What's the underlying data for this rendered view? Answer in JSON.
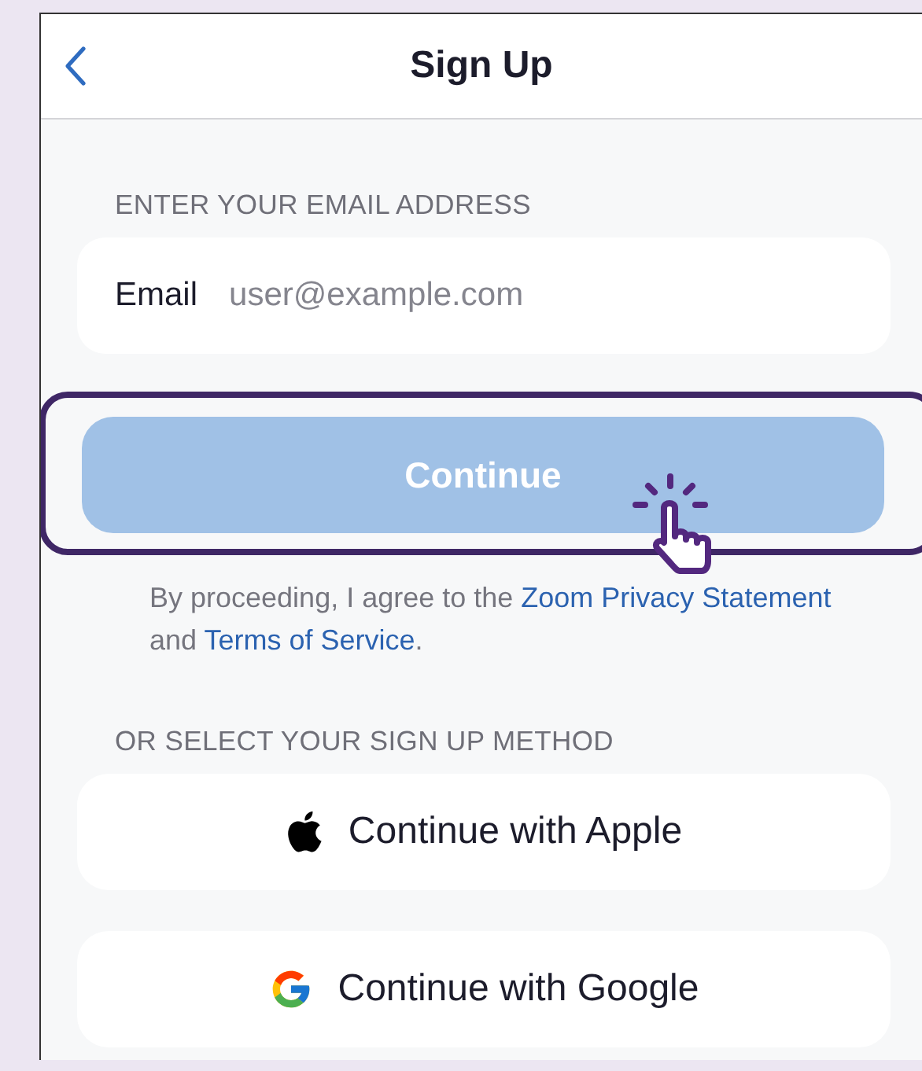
{
  "header": {
    "title": "Sign Up",
    "back": true
  },
  "email_section": {
    "label": "ENTER YOUR EMAIL ADDRESS",
    "field_label": "Email",
    "placeholder": "user@example.com"
  },
  "continue_button": {
    "label": "Continue",
    "disabled": true,
    "highlighted": true
  },
  "terms": [
    {
      "text": "By proceeding, I agree to the ",
      "link": false
    },
    {
      "text": "Zoom Privacy Statement",
      "link": true
    },
    {
      "text": " and ",
      "link": false
    },
    {
      "text": "Terms of Service",
      "link": true
    },
    {
      "text": ".",
      "link": false
    }
  ],
  "methods_label": "OR SELECT YOUR SIGN UP METHOD",
  "methods": [
    {
      "kind": "apple",
      "label": "Continue with Apple"
    },
    {
      "kind": "google",
      "label": "Continue with Google"
    }
  ]
}
